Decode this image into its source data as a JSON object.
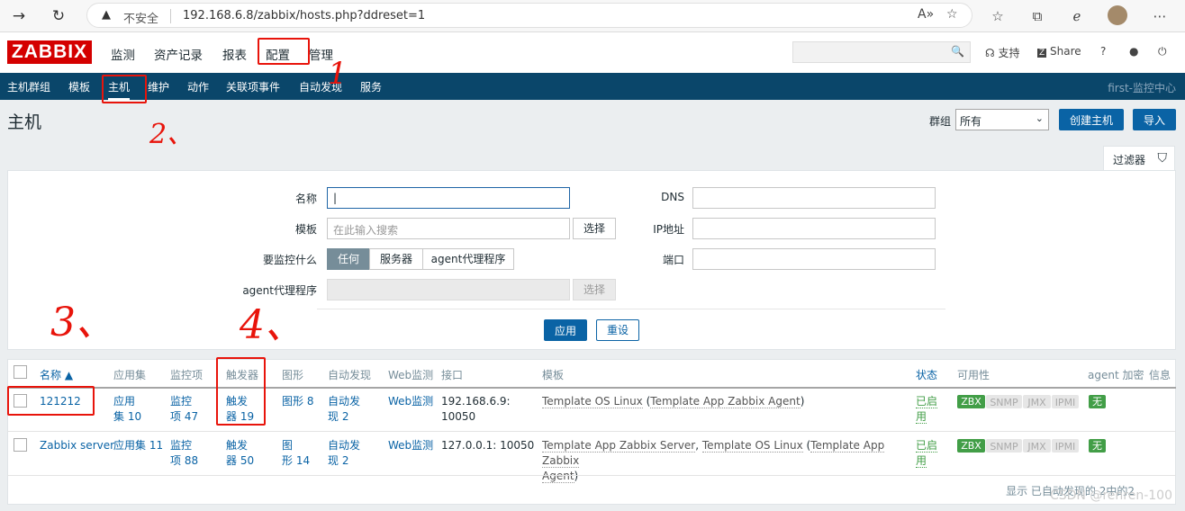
{
  "browser": {
    "security_warning": "不安全",
    "url": "192.168.6.8/zabbix/hosts.php?ddreset=1"
  },
  "header": {
    "logo": "ZABBIX",
    "menu": [
      "监测",
      "资产记录",
      "报表",
      "配置",
      "管理"
    ],
    "support": "支持",
    "share": "Share",
    "help": "?"
  },
  "submenu": {
    "items": [
      "主机群组",
      "模板",
      "主机",
      "维护",
      "动作",
      "关联项事件",
      "自动发现",
      "服务"
    ],
    "server_name": "first-监控中心"
  },
  "page": {
    "title": "主机",
    "group_label": "群组",
    "group_value": "所有",
    "create_host": "创建主机",
    "import": "导入"
  },
  "filter": {
    "tab_label": "过滤器",
    "name_label": "名称",
    "templates_label": "模板",
    "templates_placeholder": "在此输入搜索",
    "select_button": "选择",
    "monitored_by_label": "要监控什么",
    "monitored_by_options": [
      "任何",
      "服务器",
      "agent代理程序"
    ],
    "proxy_label": "agent代理程序",
    "proxy_select": "选择",
    "dns_label": "DNS",
    "ip_label": "IP地址",
    "port_label": "端口",
    "apply": "应用",
    "reset": "重设"
  },
  "table": {
    "columns": [
      "名称 ▲",
      "应用集",
      "监控项",
      "触发器",
      "图形",
      "自动发现",
      "Web监测",
      "接口",
      "模板",
      "状态",
      "可用性",
      "agent 加密",
      "信息"
    ],
    "rows": [
      {
        "name": "121212",
        "apps": [
          "应用",
          "集 10"
        ],
        "items": [
          "监控",
          "项 47"
        ],
        "triggers": [
          "触发",
          "器 19"
        ],
        "graphs": "图形 8",
        "discovery": [
          "自动发",
          "现 2"
        ],
        "web": "Web监测",
        "interface": [
          "192.168.6.9:",
          "10050"
        ],
        "template_main": "Template OS Linux",
        "template_sub": "Template App Zabbix Agent",
        "status": [
          "已启",
          "用"
        ],
        "availability": [
          "ZBX",
          "SNMP",
          "JMX",
          "IPMI"
        ],
        "encryption": "无"
      },
      {
        "name": "Zabbix server",
        "apps": "应用集 11",
        "items": [
          "监控",
          "项 88"
        ],
        "triggers": [
          "触发",
          "器 50"
        ],
        "graphs": [
          "图",
          "形 14"
        ],
        "discovery": [
          "自动发",
          "现 2"
        ],
        "web": "Web监测",
        "interface": "127.0.0.1: 10050",
        "template_a": "Template App Zabbix Server",
        "template_b": "Template OS Linux",
        "template_sub1": "Template App Zabbix",
        "template_sub2": "Agent",
        "status": [
          "已启",
          "用"
        ],
        "availability": [
          "ZBX",
          "SNMP",
          "JMX",
          "IPMI"
        ],
        "encryption": "无"
      }
    ],
    "footer": "显示 已自动发现的 2中的2",
    "watermark": "CSDN @renren-100"
  },
  "annotations": [
    "1",
    "2、",
    "3、",
    "4、"
  ],
  "colors": {
    "header_bg": "#0a466a",
    "logo_red": "#d40000",
    "link_blue": "#0a63a5",
    "zbx_green": "#429e47",
    "annotation_red": "#e8140b"
  }
}
